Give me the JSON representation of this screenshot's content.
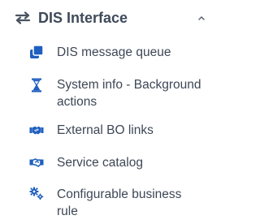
{
  "colors": {
    "accent": "#1f5fbf",
    "header_text": "#3f4a5a",
    "item_text": "#3d4756",
    "icon_gray": "#4a5360"
  },
  "section": {
    "title": "DIS Interface",
    "icon": "arrows-exchange-icon",
    "expanded": true
  },
  "items": [
    {
      "label": "DIS message queue",
      "icon": "layers-icon"
    },
    {
      "label": "System info - Background actions",
      "icon": "hourglass-icon"
    },
    {
      "label": "External BO links",
      "icon": "handshake-icon"
    },
    {
      "label": "Service catalog",
      "icon": "handshake-icon"
    },
    {
      "label": "Configurable business rule",
      "icon": "cogs-icon"
    }
  ]
}
